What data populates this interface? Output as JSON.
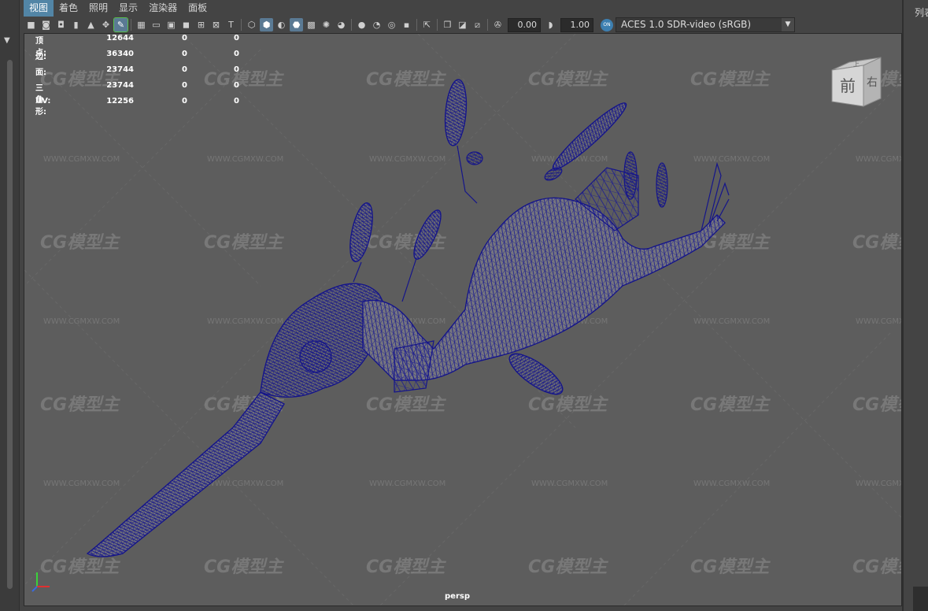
{
  "menu": {
    "items": [
      "视图",
      "着色",
      "照明",
      "显示",
      "渲染器",
      "面板"
    ],
    "active_index": 0
  },
  "toolbar": {
    "icons": [
      "select-camera-icon",
      "camera-attributes-icon",
      "bookmarks-icon",
      "image-plane-icon",
      "film-gate-icon",
      "resolution-gate-icon",
      "grease-pencil-icon",
      "grid-icon",
      "film-gate-toggle-icon",
      "resolution-gate-toggle-icon",
      "gate-mask-icon",
      "field-chart-icon",
      "safe-action-icon",
      "safe-title-icon",
      "wireframe-icon",
      "smooth-shade-icon",
      "default-material-icon",
      "wireframe-on-shaded-icon",
      "textured-icon",
      "use-all-lights-icon",
      "shadows-icon",
      "screen-space-ao-icon",
      "motion-blur-icon",
      "multisample-aa-icon",
      "depth-of-field-icon",
      "isolate-select-icon",
      "xray-icon",
      "xray-active-components-icon",
      "xray-joints-icon"
    ],
    "exposure_value": "0.00",
    "gamma_value": "1.00",
    "color_badge": "ON",
    "colorspace": "ACES 1.0 SDR-video (sRGB)"
  },
  "right_panel": {
    "label": "列表"
  },
  "stats": {
    "rows": [
      {
        "label": "顶点:",
        "v1": "12644",
        "v2": "0",
        "v3": "0"
      },
      {
        "label": "边:",
        "v1": "36340",
        "v2": "0",
        "v3": "0"
      },
      {
        "label": "面:",
        "v1": "23744",
        "v2": "0",
        "v3": "0"
      },
      {
        "label": "三角形:",
        "v1": "23744",
        "v2": "0",
        "v3": "0"
      },
      {
        "label": "UV:",
        "v1": "12256",
        "v2": "0",
        "v3": "0"
      }
    ]
  },
  "viewport": {
    "camera_label": "persp",
    "viewcube_front": "前",
    "viewcube_right": "右",
    "viewcube_top": "上",
    "watermark_logo": "CG模型主",
    "watermark_url": "WWW.CGMXW.COM"
  },
  "colors": {
    "accent": "#5285a6",
    "viewport_bg": "#5d5d5d",
    "wireframe": "#1a1a8c"
  }
}
